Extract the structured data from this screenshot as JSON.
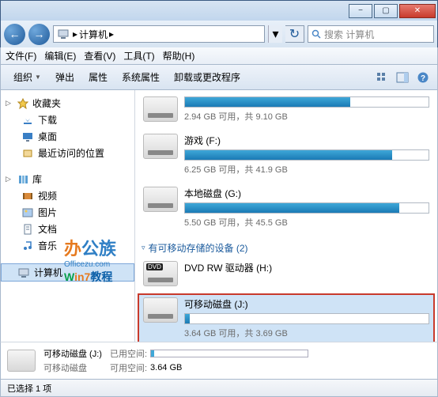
{
  "window": {
    "min_tip": "−",
    "max_tip": "▢",
    "close_tip": "✕"
  },
  "address": {
    "root": "计算机",
    "sep": "▸",
    "caret": "▾",
    "refresh": "↻"
  },
  "search": {
    "placeholder": "搜索 计算机"
  },
  "menus": {
    "file": "文件(F)",
    "edit": "编辑(E)",
    "view": "查看(V)",
    "tools": "工具(T)",
    "help": "帮助(H)"
  },
  "toolbar": {
    "organize": "组织",
    "eject": "弹出",
    "properties": "属性",
    "sys_properties": "系统属性",
    "uninstall": "卸载或更改程序"
  },
  "sidebar": {
    "favorites": {
      "label": "收藏夹"
    },
    "downloads": "下载",
    "desktop": "桌面",
    "recent": "最近访问的位置",
    "libraries": {
      "label": "库"
    },
    "videos": "视频",
    "pictures": "图片",
    "documents": "文档",
    "music": "音乐",
    "computer": "计算机"
  },
  "drives": {
    "d0": {
      "sub": "2.94 GB 可用，共 9.10 GB",
      "fill": 68
    },
    "d1": {
      "title": "游戏 (F:)",
      "sub": "6.25 GB 可用，共 41.9 GB",
      "fill": 85
    },
    "d2": {
      "title": "本地磁盘 (G:)",
      "sub": "5.50 GB 可用，共 45.5 GB",
      "fill": 88
    },
    "section": "有可移动存储的设备 (2)",
    "dvd": {
      "title": "DVD RW 驱动器 (H:)"
    },
    "usb": {
      "title": "可移动磁盘 (J:)",
      "sub": "3.64 GB 可用，共 3.69 GB",
      "fill": 2
    }
  },
  "details": {
    "name": "可移动磁盘 (J:)",
    "type": "可移动磁盘",
    "used_label": "已用空间:",
    "avail_label": "可用空间:",
    "avail_value": "3.64 GB"
  },
  "status": {
    "text": "已选择 1 项"
  },
  "watermark": {
    "brand": "办公族",
    "url": "Officezu.com",
    "w7": "Win7",
    "tut": "教程"
  }
}
